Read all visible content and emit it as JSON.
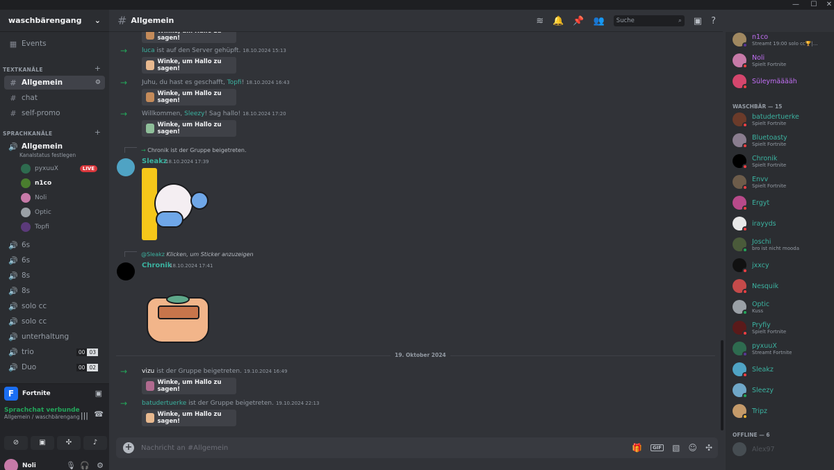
{
  "server": {
    "name": "waschbärengang"
  },
  "nav": {
    "events": "Events"
  },
  "categories": {
    "text": "TEXTKANÄLE",
    "voice": "SPRACHKANÄLE"
  },
  "text_channels": [
    "Allgemein",
    "chat",
    "self-promo"
  ],
  "voice": {
    "main": "Allgemein",
    "status": "Kanalstatus festlegen"
  },
  "voice_users": [
    {
      "name": "pyxuuX",
      "live": "LIVE"
    },
    {
      "name": "n1co"
    },
    {
      "name": "Noli"
    },
    {
      "name": "Optic"
    },
    {
      "name": "Topfi"
    }
  ],
  "voice_channels": [
    "6s",
    "6s",
    "8s",
    "8s",
    "solo cc",
    "solo cc",
    "unterhaltung",
    "trio",
    "Duo"
  ],
  "counts": {
    "trio": [
      "00",
      "03"
    ],
    "duo": [
      "00",
      "02"
    ]
  },
  "activity": {
    "game": "Fortnite",
    "logo": "F"
  },
  "voice_panel": {
    "title": "Sprachchat verbunde",
    "sub": "Allgemein / waschbärengang"
  },
  "user": {
    "name": "Noli"
  },
  "header": {
    "channel": "Allgemein",
    "search_placeholder": "Suche"
  },
  "messages": {
    "wave_label": "Winke, um Hallo zu sagen!",
    "joins": [
      {
        "before": "",
        "name": "luca",
        "after": " ist auf den Server gehüpft.",
        "ts": "18.10.2024 15:13",
        "color": "#3bb2a0"
      },
      {
        "before": "Juhu, du hast es geschafft, ",
        "name": "Topfi",
        "after": "!",
        "ts": "18.10.2024 16:43",
        "color": "#3bb2a0"
      },
      {
        "before": "Willkommen, ",
        "name": "Sleezy",
        "after": "! Sag hallo!",
        "ts": "18.10.2024 17:20",
        "color": "#3bb2a0"
      }
    ],
    "reply1": "Chronik ist der Gruppe beigetreten.",
    "sleakz": {
      "name": "Sleakz",
      "ts": "18.10.2024 17:39"
    },
    "reply2_mention": "@Sleakz",
    "reply2_text": "Klicken, um Sticker anzuzeigen",
    "chronik": {
      "name": "Chronik",
      "ts": "18.10.2024 17:41"
    },
    "divider": "19. Oktober 2024",
    "joins2": [
      {
        "name": "vizu",
        "after": " ist der Gruppe beigetreten.",
        "ts": "19.10.2024 16:49",
        "color": "#f2f3f5"
      },
      {
        "name": "batudertuerke",
        "after": " ist der Gruppe beigetreten.",
        "ts": "19.10.2024 22:13",
        "color": "#3bb2a0"
      }
    ]
  },
  "composer": {
    "placeholder": "Nachricht an #Allgemein",
    "gif": "GIF"
  },
  "members": {
    "top": [
      {
        "name": "n1co",
        "status": "Streamt 19:00 solo cc🏆|...",
        "color": "purple"
      },
      {
        "name": "Noli",
        "status": "Spielt Fortnite",
        "color": "purple"
      },
      {
        "name": "Süleymääääh",
        "status": "",
        "color": "purple"
      }
    ],
    "group": "WASCHBÄR — 15",
    "list": [
      {
        "name": "batudertuerke",
        "status": "Spielt Fortnite"
      },
      {
        "name": "Bluetoasty",
        "status": "Spielt Fortnite"
      },
      {
        "name": "Chronik",
        "status": "Spielt Fortnite"
      },
      {
        "name": "Envv",
        "status": "Spielt Fortnite"
      },
      {
        "name": "Ergyt",
        "status": ""
      },
      {
        "name": "irayyds",
        "status": ""
      },
      {
        "name": "Joschi",
        "status": "bro ist nicht mooda"
      },
      {
        "name": "jxxcy",
        "status": ""
      },
      {
        "name": "Nesquik",
        "status": ""
      },
      {
        "name": "Optic",
        "status": "Kuss"
      },
      {
        "name": "Pryfiy",
        "status": "Spielt Fortnite"
      },
      {
        "name": "pyxuuX",
        "status": "Streamt Fortnite"
      },
      {
        "name": "Sleakz",
        "status": ""
      },
      {
        "name": "Sleezy",
        "status": ""
      },
      {
        "name": "Tripz",
        "status": ""
      }
    ],
    "offline": "OFFLINE — 6",
    "offline_first": "Alex97"
  }
}
